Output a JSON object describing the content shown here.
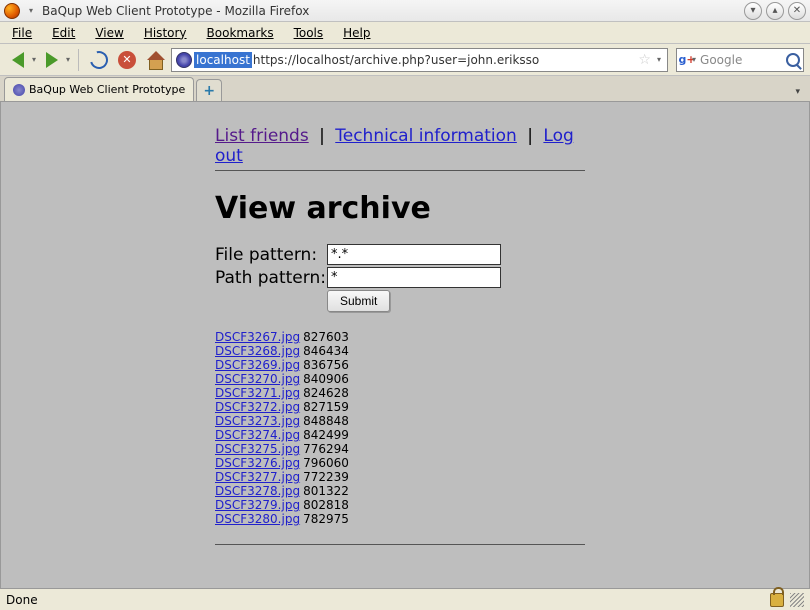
{
  "window": {
    "title": "BaQup Web Client Prototype - Mozilla Firefox"
  },
  "menubar": {
    "file": "File",
    "edit": "Edit",
    "view": "View",
    "history": "History",
    "bookmarks": "Bookmarks",
    "tools": "Tools",
    "help": "Help"
  },
  "urlbar": {
    "host_highlight": "localhost",
    "url_rest": "https://localhost/archive.php?user=john.eriksso"
  },
  "search": {
    "placeholder": "Google"
  },
  "tabs": {
    "active": "BaQup Web Client Prototype"
  },
  "page": {
    "nav": {
      "list_friends": "List friends",
      "tech_info": "Technical information",
      "logout": "Log out",
      "sep": "|"
    },
    "heading": "View archive",
    "form": {
      "file_pattern_label": "File pattern:",
      "file_pattern_value": "*.*",
      "path_pattern_label": "Path pattern:",
      "path_pattern_value": "*",
      "submit": "Submit"
    },
    "files": [
      {
        "name": "DSCF3267.jpg",
        "size": "827603"
      },
      {
        "name": "DSCF3268.jpg",
        "size": "846434"
      },
      {
        "name": "DSCF3269.jpg",
        "size": "836756"
      },
      {
        "name": "DSCF3270.jpg",
        "size": "840906"
      },
      {
        "name": "DSCF3271.jpg",
        "size": "824628"
      },
      {
        "name": "DSCF3272.jpg",
        "size": "827159"
      },
      {
        "name": "DSCF3273.jpg",
        "size": "848848"
      },
      {
        "name": "DSCF3274.jpg",
        "size": "842499"
      },
      {
        "name": "DSCF3275.jpg",
        "size": "776294"
      },
      {
        "name": "DSCF3276.jpg",
        "size": "796060"
      },
      {
        "name": "DSCF3277.jpg",
        "size": "772239"
      },
      {
        "name": "DSCF3278.jpg",
        "size": "801322"
      },
      {
        "name": "DSCF3279.jpg",
        "size": "802818"
      },
      {
        "name": "DSCF3280.jpg",
        "size": "782975"
      }
    ]
  },
  "statusbar": {
    "text": "Done"
  }
}
